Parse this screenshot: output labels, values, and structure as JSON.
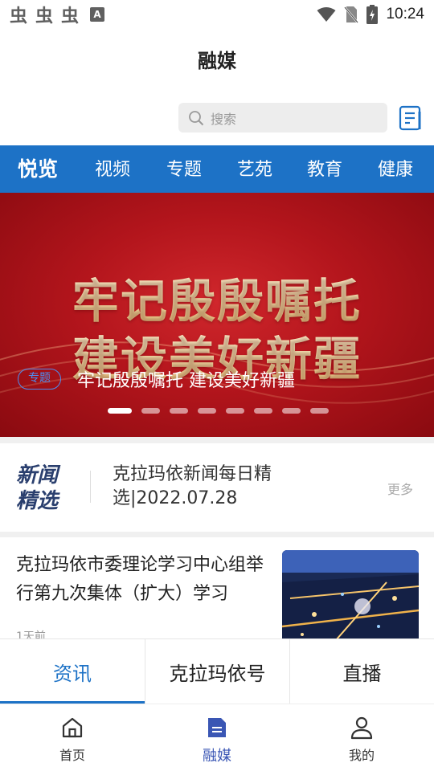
{
  "status_bar": {
    "notif_glyph": "虫",
    "a_badge": "A",
    "time": "10:24"
  },
  "header": {
    "title": "融媒"
  },
  "search": {
    "placeholder": "搜索"
  },
  "channels": [
    {
      "label": "悦览",
      "active": true
    },
    {
      "label": "视频",
      "active": false
    },
    {
      "label": "专题",
      "active": false
    },
    {
      "label": "艺苑",
      "active": false
    },
    {
      "label": "教育",
      "active": false
    },
    {
      "label": "健康",
      "active": false
    }
  ],
  "banner": {
    "headline_line1": "牢记殷殷嘱托",
    "headline_line2": "建设美好新疆",
    "tag": "专题",
    "caption": "牢记殷殷嘱托 建设美好新疆",
    "slide_count": 8,
    "active_index": 0
  },
  "news_pick": {
    "logo_line1": "新闻",
    "logo_line2": "精选",
    "title": "克拉玛依新闻每日精选|2022.07.28",
    "more": "更多"
  },
  "article": {
    "title": "克拉玛依市委理论学习中心组举行第九次集体（扩大）学习",
    "time": "1天前"
  },
  "sub_tabs": [
    {
      "label": "资讯",
      "active": true
    },
    {
      "label": "克拉玛依号",
      "active": false
    },
    {
      "label": "直播",
      "active": false
    }
  ],
  "bottom_nav": [
    {
      "label": "首页",
      "icon": "home-icon",
      "active": false
    },
    {
      "label": "融媒",
      "icon": "document-icon",
      "active": true
    },
    {
      "label": "我的",
      "icon": "person-icon",
      "active": false
    }
  ],
  "colors": {
    "brand_blue": "#1d72c6",
    "nav_active": "#3a56b4",
    "banner_red": "#b3151c"
  }
}
